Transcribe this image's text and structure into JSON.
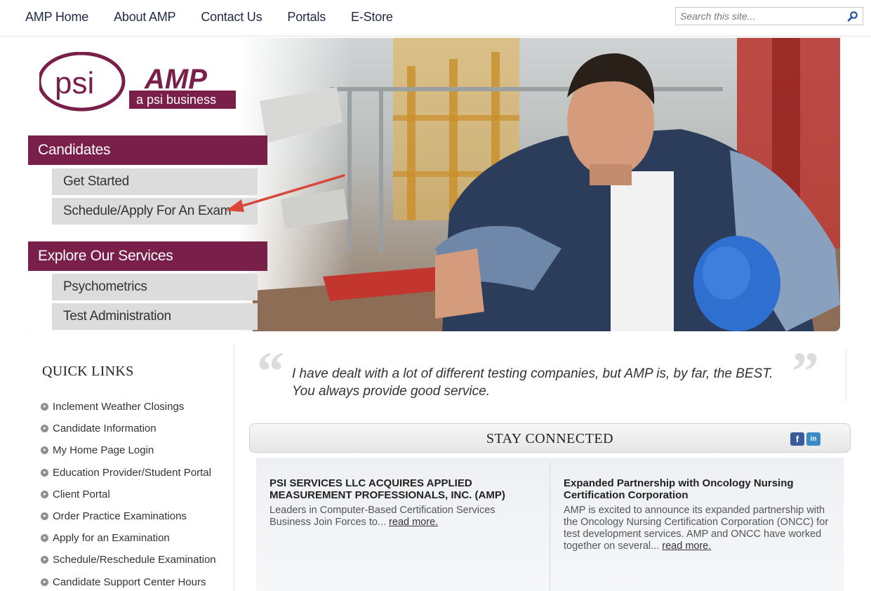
{
  "nav": {
    "links": [
      "AMP Home",
      "About AMP",
      "Contact Us",
      "Portals",
      "E-Store"
    ],
    "search_placeholder": "Search this site..."
  },
  "logo": {
    "psi": "psi",
    "amp": "AMP",
    "tagline": "a psi business"
  },
  "menu": {
    "candidates_heading": "Candidates",
    "candidates_items": [
      "Get Started",
      "Schedule/Apply For An Exam"
    ],
    "services_heading": "Explore Our Services",
    "services_items": [
      "Psychometrics",
      "Test Administration"
    ]
  },
  "quick_links": {
    "heading": "QUICK LINKS",
    "items": [
      "Inclement Weather Closings",
      "Candidate Information",
      "My Home Page Login",
      "Education Provider/Student Portal",
      "Client Portal",
      "Order Practice Examinations",
      "Apply for an Examination",
      "Schedule/Reschedule Examination",
      "Candidate Support Center Hours"
    ]
  },
  "testimonial": {
    "text": "I have dealt with a lot of different testing companies, but AMP is, by far, the BEST. You always provide good service."
  },
  "stay_connected": {
    "title": "STAY CONNECTED",
    "facebook": "f",
    "linkedin": "in"
  },
  "news": [
    {
      "title": "PSI SERVICES LLC ACQUIRES APPLIED MEASUREMENT PROFESSIONALS, INC. (AMP)",
      "body": "Leaders in Computer-Based Certification Services Business Join Forces to...",
      "more": "read more."
    },
    {
      "title": "Expanded Partnership with Oncology Nursing Certification Corporation",
      "body": "AMP is excited to announce its expanded partnership with the Oncology Nursing Certification Corporation (ONCC) for test development services. AMP and ONCC have worked together on several...",
      "more": "read more."
    }
  ],
  "colors": {
    "brand": "#7a1f4a",
    "menu_item_bg": "#dcdcdc",
    "annotation_arrow": "#d9473b",
    "nav_text": "#1f2a44"
  }
}
